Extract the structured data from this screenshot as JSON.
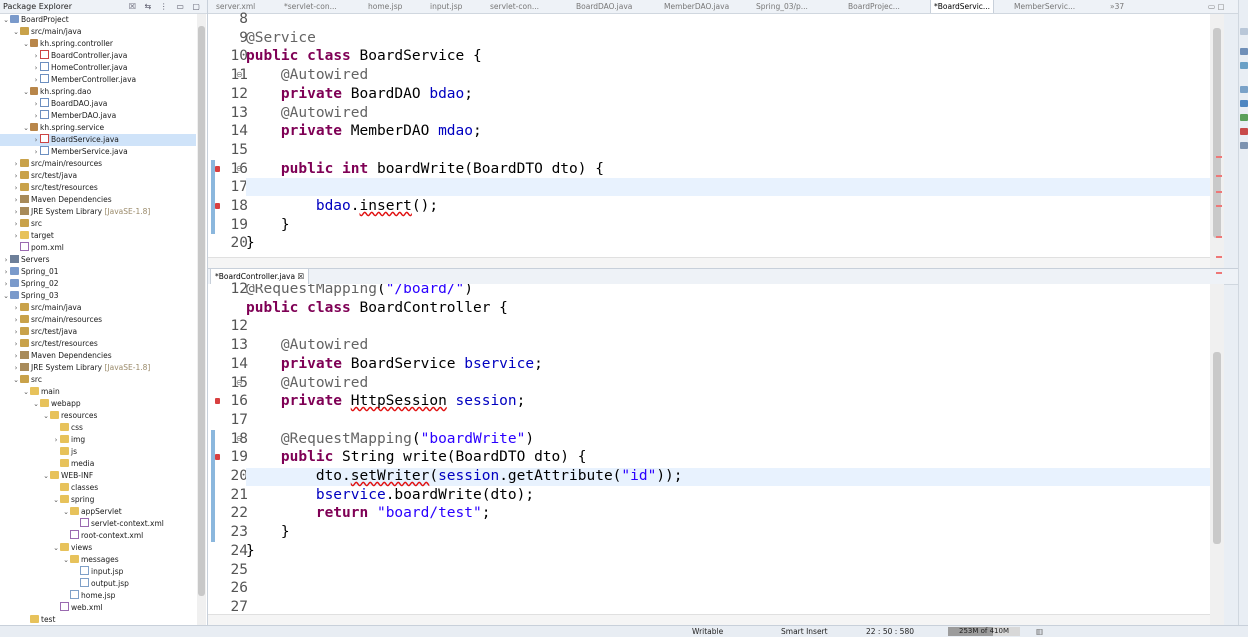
{
  "package_explorer": {
    "title": "Package Explorer",
    "tree": [
      {
        "label": "BoardProject",
        "icon": "proj",
        "twisty": "open",
        "level": 0
      },
      {
        "label": "src/main/java",
        "icon": "srcf",
        "twisty": "open",
        "level": 1
      },
      {
        "label": "kh.spring.controller",
        "icon": "pkg",
        "twisty": "open",
        "level": 2
      },
      {
        "label": "BoardController.java",
        "icon": "jerr",
        "twisty": "closed",
        "level": 3
      },
      {
        "label": "HomeController.java",
        "icon": "java",
        "twisty": "closed",
        "level": 3
      },
      {
        "label": "MemberController.java",
        "icon": "java",
        "twisty": "closed",
        "level": 3
      },
      {
        "label": "kh.spring.dao",
        "icon": "pkg",
        "twisty": "open",
        "level": 2
      },
      {
        "label": "BoardDAO.java",
        "icon": "java",
        "twisty": "closed",
        "level": 3
      },
      {
        "label": "MemberDAO.java",
        "icon": "java",
        "twisty": "closed",
        "level": 3
      },
      {
        "label": "kh.spring.service",
        "icon": "pkg",
        "twisty": "open",
        "level": 2
      },
      {
        "label": "BoardService.java",
        "icon": "jerr",
        "twisty": "closed",
        "level": 3,
        "selected": true
      },
      {
        "label": "MemberService.java",
        "icon": "java",
        "twisty": "closed",
        "level": 3
      },
      {
        "label": "src/main/resources",
        "icon": "srcf",
        "twisty": "closed",
        "level": 1
      },
      {
        "label": "src/test/java",
        "icon": "srcf",
        "twisty": "closed",
        "level": 1
      },
      {
        "label": "src/test/resources",
        "icon": "srcf",
        "twisty": "closed",
        "level": 1
      },
      {
        "label": "Maven Dependencies",
        "icon": "lib",
        "twisty": "closed",
        "level": 1
      },
      {
        "label": "JRE System Library",
        "suffix": "[JavaSE-1.8]",
        "icon": "lib",
        "twisty": "closed",
        "level": 1
      },
      {
        "label": "src",
        "icon": "srcf",
        "twisty": "closed",
        "level": 1
      },
      {
        "label": "target",
        "icon": "fold",
        "twisty": "closed",
        "level": 1
      },
      {
        "label": "pom.xml",
        "icon": "xml",
        "twisty": "none",
        "level": 1
      },
      {
        "label": "Servers",
        "icon": "srv",
        "twisty": "closed",
        "level": 0
      },
      {
        "label": "Spring_01",
        "icon": "proj",
        "twisty": "closed",
        "level": 0
      },
      {
        "label": "Spring_02",
        "icon": "proj",
        "twisty": "closed",
        "level": 0
      },
      {
        "label": "Spring_03",
        "icon": "proj",
        "twisty": "open",
        "level": 0
      },
      {
        "label": "src/main/java",
        "icon": "srcf",
        "twisty": "closed",
        "level": 1
      },
      {
        "label": "src/main/resources",
        "icon": "srcf",
        "twisty": "closed",
        "level": 1
      },
      {
        "label": "src/test/java",
        "icon": "srcf",
        "twisty": "closed",
        "level": 1
      },
      {
        "label": "src/test/resources",
        "icon": "srcf",
        "twisty": "closed",
        "level": 1
      },
      {
        "label": "Maven Dependencies",
        "icon": "lib",
        "twisty": "closed",
        "level": 1
      },
      {
        "label": "JRE System Library",
        "suffix": "[JavaSE-1.8]",
        "icon": "lib",
        "twisty": "closed",
        "level": 1
      },
      {
        "label": "src",
        "icon": "srcf",
        "twisty": "open",
        "level": 1
      },
      {
        "label": "main",
        "icon": "fold",
        "twisty": "open",
        "level": 2
      },
      {
        "label": "webapp",
        "icon": "fold",
        "twisty": "open",
        "level": 3
      },
      {
        "label": "resources",
        "icon": "fold",
        "twisty": "open",
        "level": 4
      },
      {
        "label": "css",
        "icon": "fold",
        "twisty": "none",
        "level": 5
      },
      {
        "label": "img",
        "icon": "fold",
        "twisty": "closed",
        "level": 5
      },
      {
        "label": "js",
        "icon": "fold",
        "twisty": "none",
        "level": 5
      },
      {
        "label": "media",
        "icon": "fold",
        "twisty": "none",
        "level": 5
      },
      {
        "label": "WEB-INF",
        "icon": "fold",
        "twisty": "open",
        "level": 4
      },
      {
        "label": "classes",
        "icon": "fold",
        "twisty": "none",
        "level": 5
      },
      {
        "label": "spring",
        "icon": "fold",
        "twisty": "open",
        "level": 5
      },
      {
        "label": "appServlet",
        "icon": "fold",
        "twisty": "open",
        "level": 6
      },
      {
        "label": "servlet-context.xml",
        "icon": "xml",
        "twisty": "none",
        "level": 7
      },
      {
        "label": "root-context.xml",
        "icon": "xml",
        "twisty": "none",
        "level": 6
      },
      {
        "label": "views",
        "icon": "fold",
        "twisty": "open",
        "level": 5
      },
      {
        "label": "messages",
        "icon": "fold",
        "twisty": "open",
        "level": 6
      },
      {
        "label": "input.jsp",
        "icon": "jsp",
        "twisty": "none",
        "level": 7
      },
      {
        "label": "output.jsp",
        "icon": "jsp",
        "twisty": "none",
        "level": 7
      },
      {
        "label": "home.jsp",
        "icon": "jsp",
        "twisty": "none",
        "level": 6
      },
      {
        "label": "web.xml",
        "icon": "xml",
        "twisty": "none",
        "level": 5
      },
      {
        "label": "test",
        "icon": "fold",
        "twisty": "none",
        "level": 2
      }
    ]
  },
  "editor_tabs": [
    {
      "label": "server.xml",
      "active": false
    },
    {
      "label": "*servlet-con...",
      "active": false
    },
    {
      "label": "home.jsp",
      "active": false
    },
    {
      "label": "input.jsp",
      "active": false
    },
    {
      "label": "servlet-con...",
      "active": false
    },
    {
      "label": "BoardDAO.java",
      "active": false
    },
    {
      "label": "MemberDAO.java",
      "active": false
    },
    {
      "label": "Spring_03/p...",
      "active": false
    },
    {
      "label": "BoardProjec...",
      "active": false
    },
    {
      "label": "*BoardServic...",
      "active": true
    },
    {
      "label": "MemberServic...",
      "active": false
    },
    {
      "label": "»37",
      "active": false
    }
  ],
  "editor1": {
    "lines": [
      {
        "n": "8",
        "code": ""
      },
      {
        "n": "9",
        "code": "@Service"
      },
      {
        "n": "10",
        "code": "public class BoardService {"
      },
      {
        "n": "11",
        "code": "    @Autowired"
      },
      {
        "n": "12",
        "code": "    private BoardDAO bdao;"
      },
      {
        "n": "13",
        "code": "    @Autowired"
      },
      {
        "n": "14",
        "code": "    private MemberDAO mdao;"
      },
      {
        "n": "15",
        "code": ""
      },
      {
        "n": "16",
        "code": "    public int boardWrite(BoardDTO dto) {"
      },
      {
        "n": "17",
        "code": ""
      },
      {
        "n": "18",
        "code": "        bdao.insert();"
      },
      {
        "n": "19",
        "code": "    }"
      },
      {
        "n": "20",
        "code": "}"
      }
    ]
  },
  "editor2": {
    "tab_label": "*BoardController.java",
    "lines": [
      {
        "n": "12",
        "code": "@RequestMapping(\"/board/\")"
      },
      {
        "n": "",
        "code": "public class BoardController {"
      },
      {
        "n": "12",
        "code": ""
      },
      {
        "n": "13",
        "code": "    @Autowired"
      },
      {
        "n": "14",
        "code": "    private BoardService bservice;"
      },
      {
        "n": "15",
        "code": "    @Autowired"
      },
      {
        "n": "16",
        "code": "    private HttpSession session;"
      },
      {
        "n": "17",
        "code": ""
      },
      {
        "n": "18",
        "code": "    @RequestMapping(\"boardWrite\")"
      },
      {
        "n": "19",
        "code": "    public String write(BoardDTO dto) {"
      },
      {
        "n": "20",
        "code": "        dto.setWriter(session.getAttribute(\"id\"));"
      },
      {
        "n": "21",
        "code": "        bservice.boardWrite(dto);"
      },
      {
        "n": "22",
        "code": "        return \"board/test\";"
      },
      {
        "n": "23",
        "code": "    }"
      },
      {
        "n": "24",
        "code": "}"
      },
      {
        "n": "25",
        "code": ""
      },
      {
        "n": "26",
        "code": ""
      },
      {
        "n": "27",
        "code": ""
      }
    ]
  },
  "status": {
    "writable": "Writable",
    "insert_mode": "Smart Insert",
    "position": "22 : 50 : 580",
    "heap": "253M of 410M",
    "heap_used_fraction": 0.62
  }
}
